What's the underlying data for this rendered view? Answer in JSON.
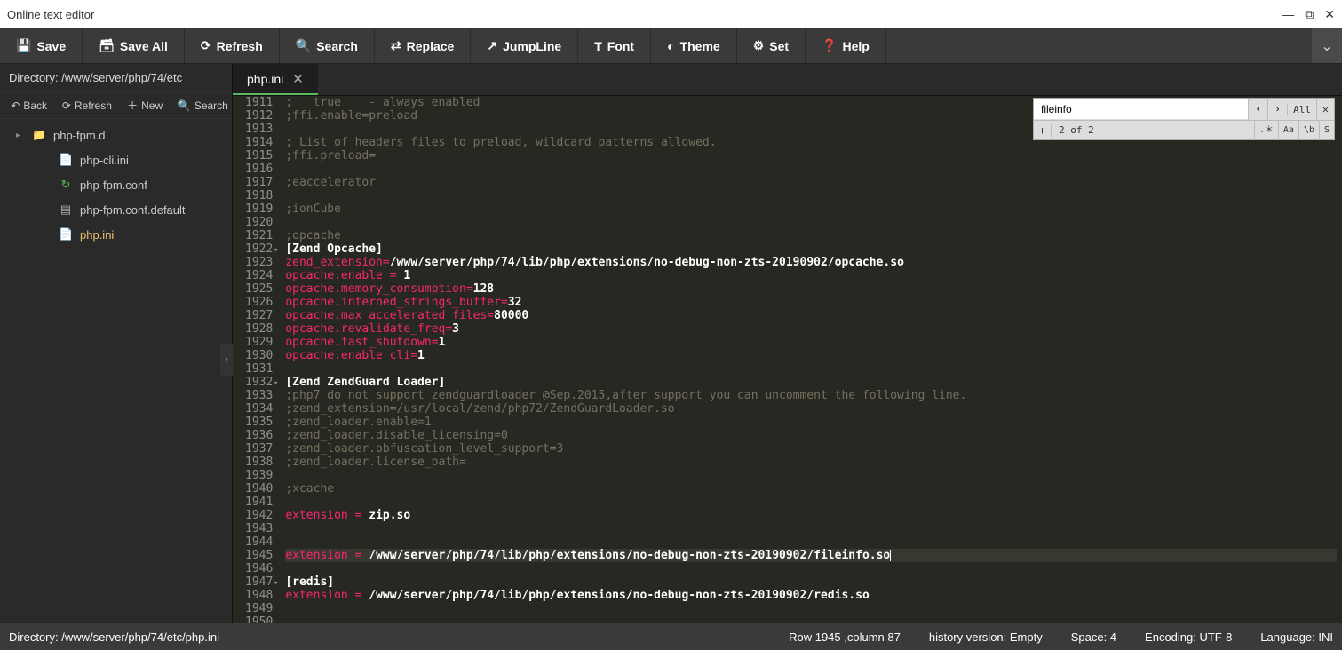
{
  "window": {
    "title": "Online text editor"
  },
  "toolbar": {
    "save": "Save",
    "saveall": "Save All",
    "refresh": "Refresh",
    "search": "Search",
    "replace": "Replace",
    "jumpline": "JumpLine",
    "font": "Font",
    "theme": "Theme",
    "set": "Set",
    "help": "Help"
  },
  "sidebar": {
    "directory_label": "Directory: /www/server/php/74/etc",
    "btns": {
      "back": "Back",
      "refresh": "Refresh",
      "new": "New",
      "search": "Search"
    },
    "tree": [
      {
        "name": "php-fpm.d",
        "type": "folder",
        "caret": "▸"
      },
      {
        "name": "php-cli.ini",
        "type": "file",
        "indent": true
      },
      {
        "name": "php-fpm.conf",
        "type": "conf",
        "indent": true,
        "icon": "↻"
      },
      {
        "name": "php-fpm.conf.default",
        "type": "file",
        "indent": true,
        "icon": "▤"
      },
      {
        "name": "php.ini",
        "type": "file",
        "indent": true,
        "active": true
      }
    ]
  },
  "tabs": [
    {
      "label": "php.ini"
    }
  ],
  "searchbox": {
    "value": "fileinfo",
    "count": "2 of 2",
    "all": "All",
    "opts": [
      ".＊",
      "Aa",
      "\\b",
      "S"
    ]
  },
  "lines": [
    {
      "n": 1911,
      "cls": "c-comment",
      "t": ";   true    - always enabled"
    },
    {
      "n": 1912,
      "cls": "c-comment",
      "t": ";ffi.enable=preload"
    },
    {
      "n": 1913,
      "cls": "",
      "t": ""
    },
    {
      "n": 1914,
      "cls": "c-comment",
      "t": "; List of headers files to preload, wildcard patterns allowed."
    },
    {
      "n": 1915,
      "cls": "c-comment",
      "t": ";ffi.preload="
    },
    {
      "n": 1916,
      "cls": "",
      "t": ""
    },
    {
      "n": 1917,
      "cls": "c-comment",
      "t": ";eaccelerator"
    },
    {
      "n": 1918,
      "cls": "",
      "t": ""
    },
    {
      "n": 1919,
      "cls": "c-comment",
      "t": ";ionCube"
    },
    {
      "n": 1920,
      "cls": "",
      "t": ""
    },
    {
      "n": 1921,
      "cls": "c-comment",
      "t": ";opcache"
    },
    {
      "n": 1922,
      "cls": "c-sec",
      "fold": true,
      "t": "[Zend Opcache]"
    },
    {
      "n": 1923,
      "kv": true,
      "k": "zend_extension",
      "sep": "=",
      "v": "/www/server/php/74/lib/php/extensions/no-debug-non-zts-20190902/opcache.so"
    },
    {
      "n": 1924,
      "kv": true,
      "k": "opcache.enable",
      "sep": " = ",
      "v": "1"
    },
    {
      "n": 1925,
      "kv": true,
      "k": "opcache.memory_consumption",
      "sep": "=",
      "v": "128"
    },
    {
      "n": 1926,
      "kv": true,
      "k": "opcache.interned_strings_buffer",
      "sep": "=",
      "v": "32"
    },
    {
      "n": 1927,
      "kv": true,
      "k": "opcache.max_accelerated_files",
      "sep": "=",
      "v": "80000"
    },
    {
      "n": 1928,
      "kv": true,
      "k": "opcache.revalidate_freq",
      "sep": "=",
      "v": "3"
    },
    {
      "n": 1929,
      "kv": true,
      "k": "opcache.fast_shutdown",
      "sep": "=",
      "v": "1"
    },
    {
      "n": 1930,
      "kv": true,
      "k": "opcache.enable_cli",
      "sep": "=",
      "v": "1"
    },
    {
      "n": 1931,
      "cls": "",
      "t": ""
    },
    {
      "n": 1932,
      "cls": "c-sec",
      "fold": true,
      "t": "[Zend ZendGuard Loader]"
    },
    {
      "n": 1933,
      "cls": "c-comment",
      "t": ";php7 do not support zendguardloader @Sep.2015,after support you can uncomment the following line."
    },
    {
      "n": 1934,
      "cls": "c-comment",
      "t": ";zend_extension=/usr/local/zend/php72/ZendGuardLoader.so"
    },
    {
      "n": 1935,
      "cls": "c-comment",
      "t": ";zend_loader.enable=1"
    },
    {
      "n": 1936,
      "cls": "c-comment",
      "t": ";zend_loader.disable_licensing=0"
    },
    {
      "n": 1937,
      "cls": "c-comment",
      "t": ";zend_loader.obfuscation_level_support=3"
    },
    {
      "n": 1938,
      "cls": "c-comment",
      "t": ";zend_loader.license_path="
    },
    {
      "n": 1939,
      "cls": "",
      "t": ""
    },
    {
      "n": 1940,
      "cls": "c-comment",
      "t": ";xcache"
    },
    {
      "n": 1941,
      "cls": "",
      "t": ""
    },
    {
      "n": 1942,
      "kv": true,
      "k": "extension",
      "sep": " = ",
      "v": "zip.so"
    },
    {
      "n": 1943,
      "cls": "",
      "t": ""
    },
    {
      "n": 1944,
      "cls": "",
      "t": ""
    },
    {
      "n": 1945,
      "kv": true,
      "hl": true,
      "k": "extension",
      "sep": " = ",
      "v": "/www/server/php/74/lib/php/extensions/no-debug-non-zts-20190902/fileinfo.so",
      "cursor": true
    },
    {
      "n": 1946,
      "cls": "",
      "t": ""
    },
    {
      "n": 1947,
      "cls": "c-sec",
      "fold": true,
      "t": "[redis]"
    },
    {
      "n": 1948,
      "kv": true,
      "k": "extension",
      "sep": " = ",
      "v": "/www/server/php/74/lib/php/extensions/no-debug-non-zts-20190902/redis.so"
    },
    {
      "n": 1949,
      "cls": "",
      "t": ""
    },
    {
      "n": 1950,
      "cls": "",
      "t": ""
    }
  ],
  "status": {
    "path": "Directory: /www/server/php/74/etc/php.ini",
    "rowcol": "Row 1945 ,column 87",
    "history": "history version: Empty",
    "space": "Space: 4",
    "encoding": "Encoding: UTF-8",
    "lang": "Language: INI"
  }
}
